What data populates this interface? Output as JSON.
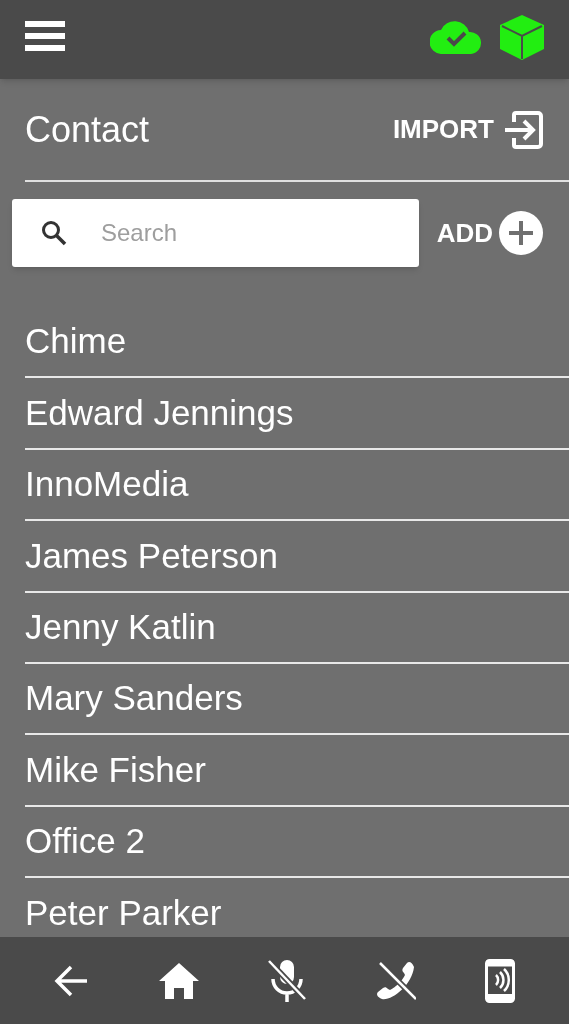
{
  "header": {
    "title": "Contact",
    "import_label": "IMPORT"
  },
  "search": {
    "placeholder": "Search"
  },
  "add_label": "ADD",
  "contacts": [
    {
      "name": "Chime"
    },
    {
      "name": "Edward Jennings"
    },
    {
      "name": "InnoMedia"
    },
    {
      "name": "James Peterson"
    },
    {
      "name": "Jenny Katlin"
    },
    {
      "name": "Mary Sanders"
    },
    {
      "name": "Mike Fisher"
    },
    {
      "name": "Office 2"
    },
    {
      "name": "Peter Parker"
    }
  ]
}
